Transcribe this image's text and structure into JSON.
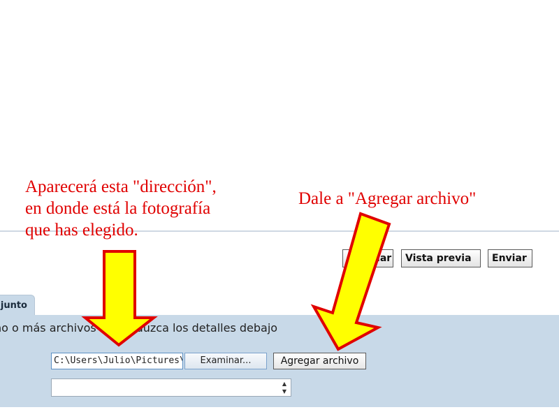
{
  "annotations": {
    "left_line1": "Aparecerá esta \"dirección\",",
    "left_line2": "en donde está la fotografía",
    "left_line3": "que has elegido.",
    "right": "Dale a \"Agregar archivo\""
  },
  "toolbar": {
    "preview_save_label": "Guardar",
    "preview_label": "Vista previa",
    "send_label": "Enviar"
  },
  "attachment": {
    "tab_label": "junto",
    "instructions": "no o más archivos e introduzca los detalles debajo",
    "file_path": "C:\\Users\\Julio\\Pictures\\",
    "browse_label": "Examinar...",
    "add_label": "Agregar archivo"
  },
  "colors": {
    "annotation": "#e00000",
    "arrow_fill": "#ffff00",
    "arrow_stroke": "#e00000",
    "panel": "#c8d9e8"
  }
}
